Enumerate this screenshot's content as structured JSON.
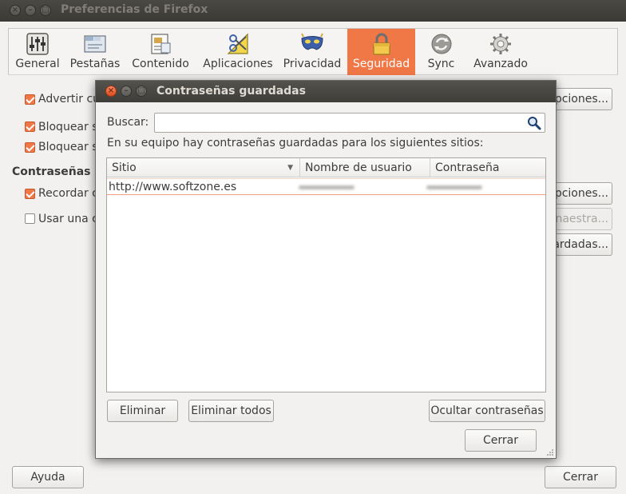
{
  "window": {
    "title": "Preferencias de Firefox"
  },
  "toolbar": {
    "items": [
      {
        "label": "General",
        "icon": "sliders-icon"
      },
      {
        "label": "Pestañas",
        "icon": "tabs-icon"
      },
      {
        "label": "Contenido",
        "icon": "content-icon"
      },
      {
        "label": "Aplicaciones",
        "icon": "applications-icon"
      },
      {
        "label": "Privacidad",
        "icon": "mask-icon"
      },
      {
        "label": "Seguridad",
        "icon": "padlock-icon",
        "active": true
      },
      {
        "label": "Sync",
        "icon": "sync-icon"
      },
      {
        "label": "Avanzado",
        "icon": "gear-icon"
      }
    ],
    "active_color": "#f07746"
  },
  "background": {
    "checkbox1": "Advertir cu",
    "checkbox2": "Bloquear s",
    "checkbox3": "Bloquear s",
    "section_passwords": "Contraseñas",
    "checkbox4": "Recordar c",
    "checkbox5": "Usar una c",
    "btn_exceptions1": "pciones...",
    "btn_exceptions2": "pciones...",
    "btn_master": "naestra...",
    "btn_saved": "ardadas...",
    "help_button": "Ayuda",
    "close_button": "Cerrar"
  },
  "dialog": {
    "title": "Contraseñas guardadas",
    "search_label": "Buscar:",
    "search_value": "",
    "info_text": "En su equipo hay contraseñas guardadas para los siguientes sitios:",
    "columns": [
      "Sitio",
      "Nombre de usuario",
      "Contraseña"
    ],
    "rows": [
      {
        "site": "http://www.softzone.es"
      }
    ],
    "btn_remove": "Eliminar",
    "btn_remove_all": "Eliminar todos",
    "btn_hide_passwords": "Ocultar contraseñas",
    "btn_close": "Cerrar"
  }
}
